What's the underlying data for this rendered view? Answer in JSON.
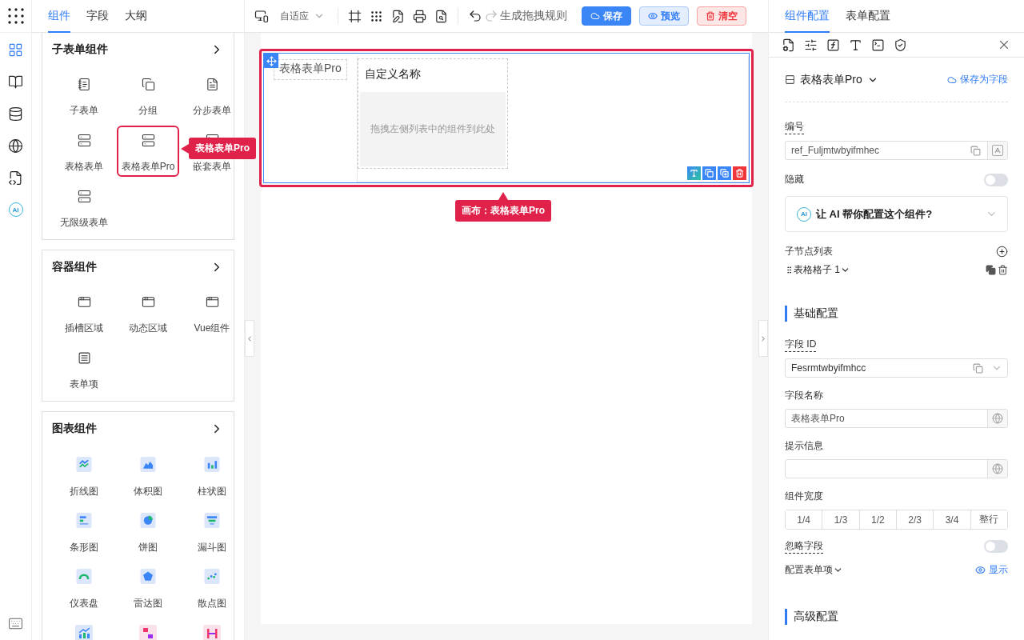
{
  "rail": {
    "items": [
      {
        "kind": "components",
        "selected": true
      },
      {
        "kind": "book",
        "selected": false
      },
      {
        "kind": "database",
        "selected": false
      },
      {
        "kind": "globe",
        "selected": false
      },
      {
        "kind": "code",
        "selected": false
      },
      {
        "kind": "ai",
        "label": "AI",
        "selected": false
      }
    ]
  },
  "left_panel": {
    "tabs": [
      {
        "label": "组件",
        "selected": true
      },
      {
        "label": "字段",
        "selected": false
      },
      {
        "label": "大纲",
        "selected": false
      }
    ],
    "groups": [
      {
        "title": "子表单组件",
        "items": [
          {
            "label": "子表单",
            "kind": "subform",
            "highlighted": false
          },
          {
            "label": "分组",
            "kind": "group",
            "highlighted": false
          },
          {
            "label": "分步表单",
            "kind": "steps",
            "highlighted": false
          },
          {
            "label": "表格表单",
            "kind": "table",
            "highlighted": false
          },
          {
            "label": "表格表单Pro",
            "kind": "table",
            "highlighted": true
          },
          {
            "label": "嵌套表单",
            "kind": "table",
            "highlighted": false
          },
          {
            "label": "无限级表单",
            "kind": "infinite",
            "highlighted": false
          }
        ]
      },
      {
        "title": "容器组件",
        "items": [
          {
            "label": "插槽区域",
            "kind": "slot",
            "highlighted": false
          },
          {
            "label": "动态区域",
            "kind": "json",
            "highlighted": false
          },
          {
            "label": "Vue组件",
            "kind": "vue",
            "highlighted": false
          },
          {
            "label": "表单项",
            "kind": "formitem",
            "highlighted": false
          }
        ]
      },
      {
        "title": "图表组件",
        "items": [
          {
            "label": "折线图",
            "kind": "line",
            "highlighted": false
          },
          {
            "label": "体积图",
            "kind": "area",
            "highlighted": false
          },
          {
            "label": "柱状图",
            "kind": "bar",
            "highlighted": false
          },
          {
            "label": "条形图",
            "kind": "hbar",
            "highlighted": false
          },
          {
            "label": "饼图",
            "kind": "pie",
            "highlighted": false
          },
          {
            "label": "漏斗图",
            "kind": "funnel",
            "highlighted": false
          },
          {
            "label": "仪表盘",
            "kind": "gauge",
            "highlighted": false
          },
          {
            "label": "雷达图",
            "kind": "radar",
            "highlighted": false
          },
          {
            "label": "散点图",
            "kind": "scatter",
            "highlighted": false
          },
          {
            "kind": "combo",
            "highlighted": false
          },
          {
            "kind": "flow",
            "highlighted": false
          },
          {
            "kind": "range",
            "highlighted": false
          }
        ]
      }
    ]
  },
  "drag_callout": "表格表单Pro",
  "toolbar": {
    "device_mode": "自适应",
    "undo_enabled": true,
    "redo_enabled": false,
    "rule_button": "生成拖拽规则",
    "buttons": [
      {
        "label": "保存",
        "kind": "primary"
      },
      {
        "label": "预览",
        "kind": "info"
      },
      {
        "label": "清空",
        "kind": "danger"
      }
    ]
  },
  "canvas": {
    "component_label": "表格表单Pro",
    "cell_title": "自定义名称",
    "drop_hint": "拖拽左侧列表中的组件到此处",
    "selected": true
  },
  "canvas_callout": "画布：表格表单Pro",
  "config_panel": {
    "tabs": [
      {
        "label": "组件配置",
        "selected": true
      },
      {
        "label": "表单配置",
        "selected": false
      }
    ],
    "component": "表格表单Pro",
    "save_as_field": "保存为字段",
    "ref": {
      "label": "编号",
      "value": "ref_Fuljmtwbyifmhec"
    },
    "hidden": {
      "label": "隐藏",
      "on": false
    },
    "ai_prompt": {
      "badge": "AI",
      "label": "让 AI 帮你配置这个组件?",
      "expanded": false
    },
    "children": {
      "label": "子节点列表",
      "items": [
        {
          "label": "表格格子 1"
        }
      ]
    },
    "sections": [
      {
        "title": "基础配置",
        "fields": [
          {
            "kind": "select",
            "label": "字段 ID",
            "value": "Fesrmtwbyifmhcc",
            "dashed": true
          },
          {
            "kind": "i18n",
            "label": "字段名称",
            "value": "表格表单Pro",
            "dashed": false
          },
          {
            "kind": "i18n",
            "label": "提示信息",
            "dashed": false
          },
          {
            "kind": "segments",
            "label": "组件宽度",
            "dashed": false,
            "options": [
              {
                "label": "1/4",
                "selected": false
              },
              {
                "label": "1/3",
                "selected": false
              },
              {
                "label": "1/2",
                "selected": false
              },
              {
                "label": "2/3",
                "selected": false
              },
              {
                "label": "3/4",
                "selected": false
              },
              {
                "label": "整行",
                "selected": false
              }
            ]
          },
          {
            "kind": "switch",
            "label": "忽略字段",
            "on": false,
            "dashed": true
          },
          {
            "kind": "toggle-row",
            "label": "配置表单项",
            "action": "显示",
            "dashed": false
          }
        ]
      },
      {
        "title": "高级配置"
      }
    ]
  }
}
